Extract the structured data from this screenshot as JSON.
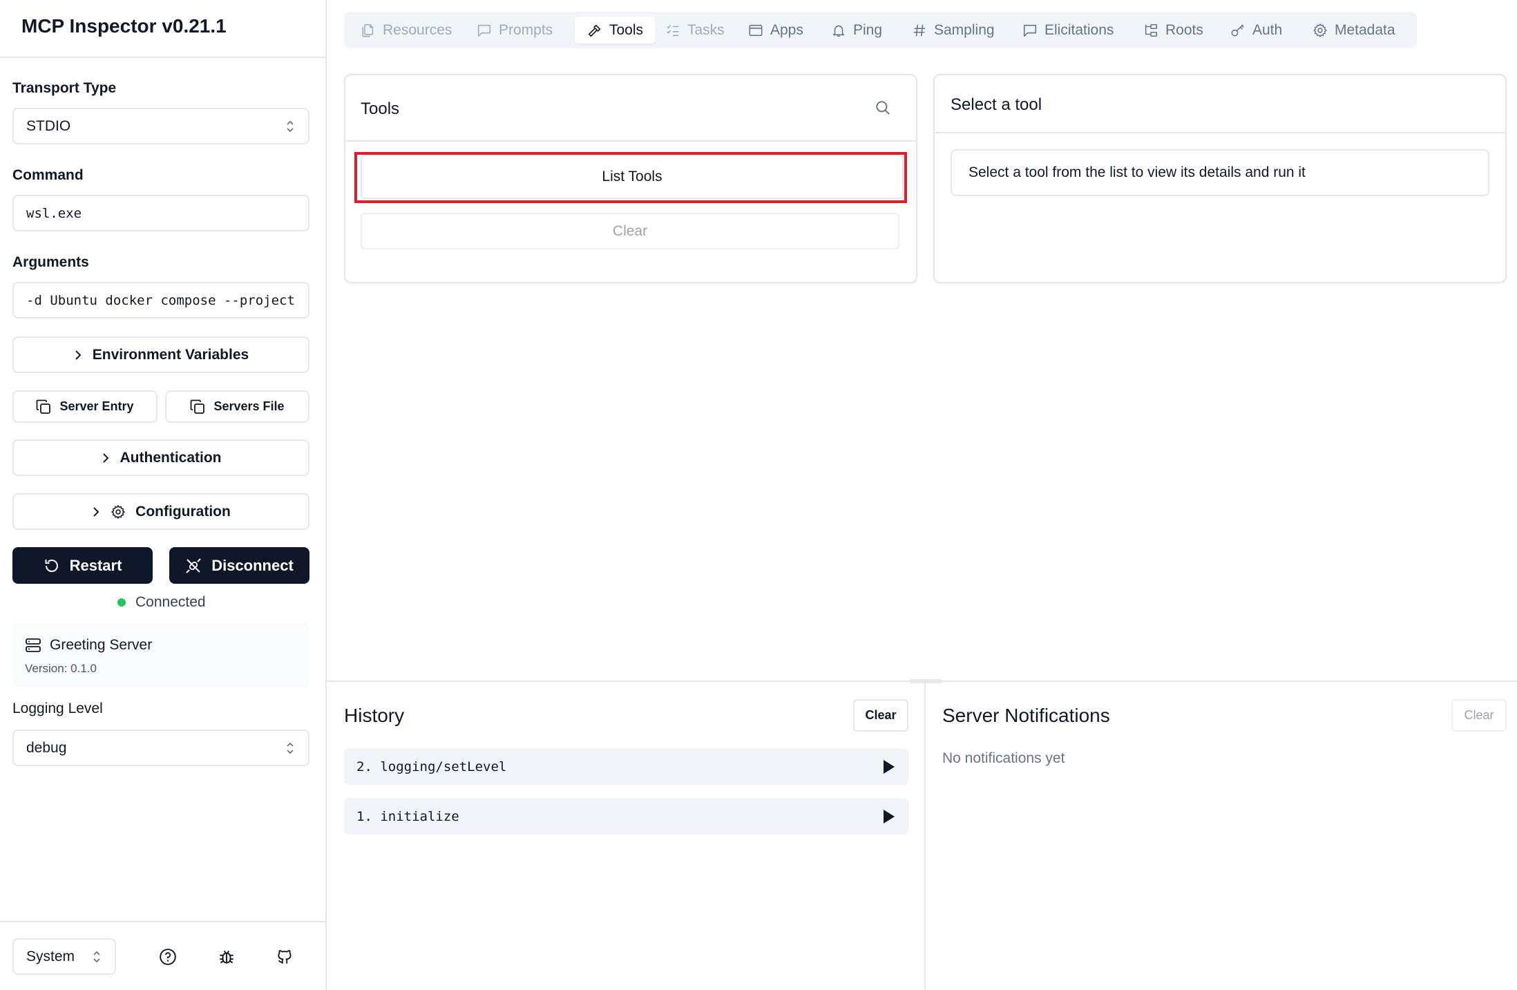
{
  "app": {
    "title": "MCP Inspector v0.21.1"
  },
  "sidebar": {
    "transport_label": "Transport Type",
    "transport_value": "STDIO",
    "command_label": "Command",
    "command_value": "wsl.exe",
    "arguments_label": "Arguments",
    "arguments_value": "-d Ubuntu docker compose --project",
    "env_vars_label": "Environment Variables",
    "server_entry_label": "Server Entry",
    "servers_file_label": "Servers File",
    "auth_label": "Authentication",
    "config_label": "Configuration",
    "restart_label": "Restart",
    "disconnect_label": "Disconnect",
    "status_text": "Connected",
    "server_name": "Greeting Server",
    "server_version": "Version: 0.1.0",
    "logging_label": "Logging Level",
    "logging_value": "debug",
    "theme_value": "System"
  },
  "tabs": [
    {
      "label": "Resources",
      "state": "disabled"
    },
    {
      "label": "Prompts",
      "state": "disabled"
    },
    {
      "label": "Tools",
      "state": "active"
    },
    {
      "label": "Tasks",
      "state": "disabled"
    },
    {
      "label": "Apps",
      "state": "normal"
    },
    {
      "label": "Ping",
      "state": "normal"
    },
    {
      "label": "Sampling",
      "state": "normal"
    },
    {
      "label": "Elicitations",
      "state": "normal"
    },
    {
      "label": "Roots",
      "state": "normal"
    },
    {
      "label": "Auth",
      "state": "normal"
    },
    {
      "label": "Metadata",
      "state": "normal"
    }
  ],
  "tools_panel": {
    "title": "Tools",
    "list_tools_label": "List Tools",
    "clear_label": "Clear"
  },
  "detail_panel": {
    "title": "Select a tool",
    "message": "Select a tool from the list to view its details and run it"
  },
  "history": {
    "title": "History",
    "clear_label": "Clear",
    "items": [
      "2. logging/setLevel",
      "1. initialize"
    ]
  },
  "notifications": {
    "title": "Server Notifications",
    "clear_label": "Clear",
    "empty_text": "No notifications yet"
  },
  "colors": {
    "status_connected": "#22c55e",
    "primary_dark": "#0f172a",
    "highlight": "#e11d2a"
  }
}
